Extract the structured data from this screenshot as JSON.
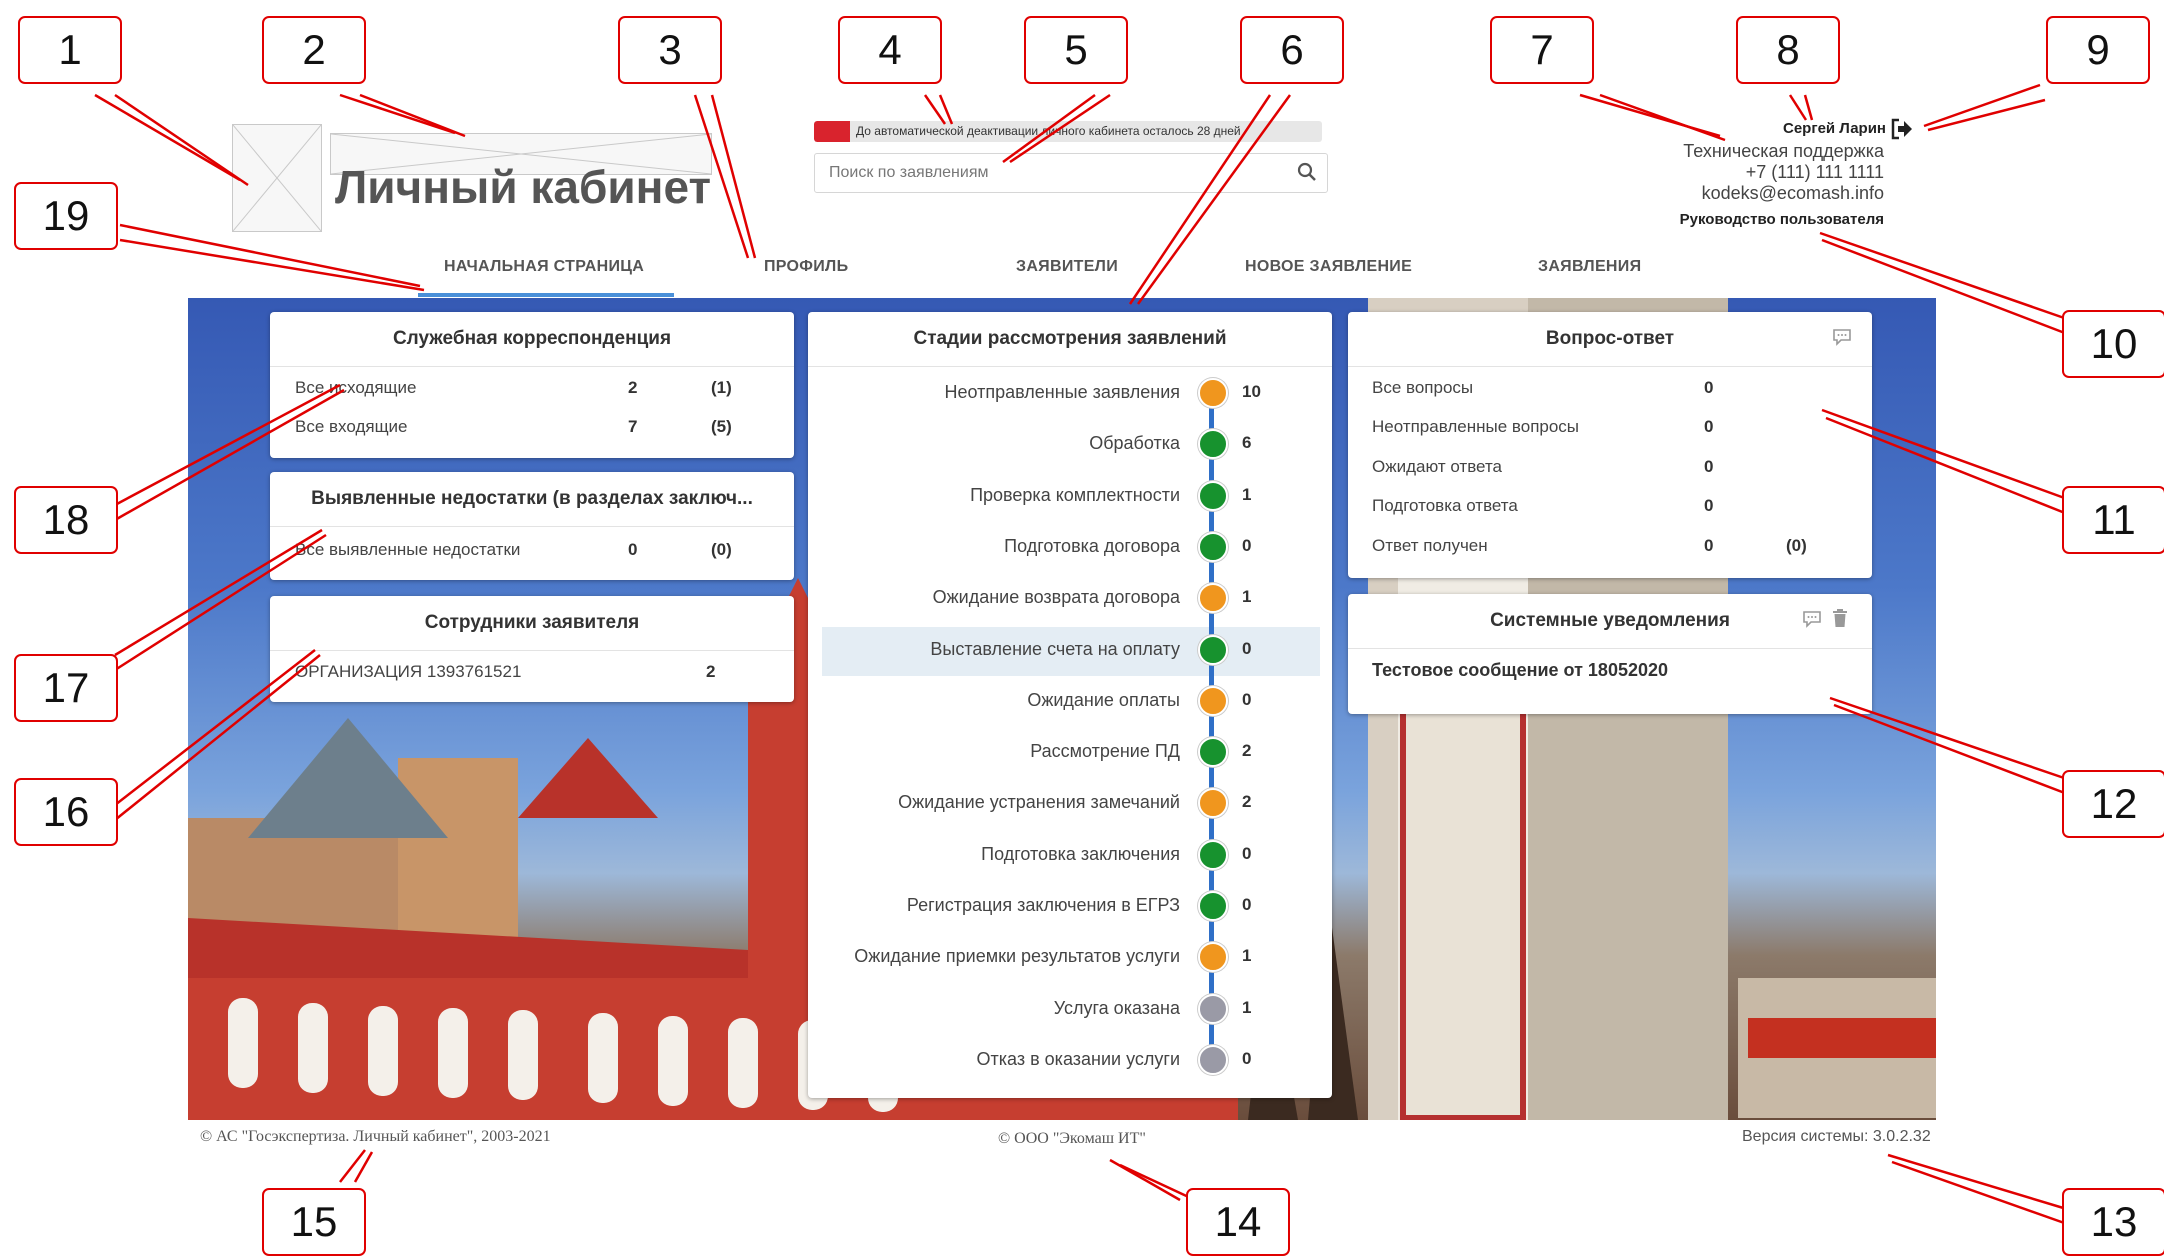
{
  "header": {
    "app_title": "Личный кабинет",
    "deactivation_text": "До автоматической деактивации личного кабинета осталось 28 дней",
    "deactivation_fraction": 0.07,
    "search_placeholder": "Поиск по заявлениям",
    "user_name": "Сергей Ларин",
    "support_title": "Техническая поддержка",
    "support_phone": "+7 (111) 111 1111",
    "support_email": "kodeks@ecomash.info",
    "user_guide": "Руководство пользователя"
  },
  "nav": {
    "items": [
      "НАЧАЛЬНАЯ СТРАНИЦА",
      "ПРОФИЛЬ",
      "ЗАЯВИТЕЛИ",
      "НОВОЕ ЗАЯВЛЕНИЕ",
      "ЗАЯВЛЕНИЯ"
    ],
    "active": "НАЧАЛЬНАЯ СТРАНИЦА"
  },
  "correspondence": {
    "title": "Служебная корреспонденция",
    "rows": [
      {
        "label": "Все исходящие",
        "count": "2",
        "extra": "(1)"
      },
      {
        "label": "Все входящие",
        "count": "7",
        "extra": "(5)"
      }
    ]
  },
  "deficiencies": {
    "title": "Выявленные недостатки (в разделах заключ...",
    "rows": [
      {
        "label": "Все выявленные недостатки",
        "count": "0",
        "extra": "(0)"
      }
    ]
  },
  "employees": {
    "title": "Сотрудники заявителя",
    "rows": [
      {
        "label": "ОРГАНИЗАЦИЯ 1393761521",
        "count": "2"
      }
    ]
  },
  "stages": {
    "title": "Стадии рассмотрения заявлений",
    "items": [
      {
        "label": "Неотправленные заявления",
        "count": "10",
        "status": "orange"
      },
      {
        "label": "Обработка",
        "count": "6",
        "status": "green"
      },
      {
        "label": "Проверка комплектности",
        "count": "1",
        "status": "green"
      },
      {
        "label": "Подготовка договора",
        "count": "0",
        "status": "green"
      },
      {
        "label": "Ожидание возврата договора",
        "count": "1",
        "status": "orange"
      },
      {
        "label": "Выставление счета на оплату",
        "count": "0",
        "status": "green"
      },
      {
        "label": "Ожидание оплаты",
        "count": "0",
        "status": "orange"
      },
      {
        "label": "Рассмотрение ПД",
        "count": "2",
        "status": "green"
      },
      {
        "label": "Ожидание устранения замечаний",
        "count": "2",
        "status": "orange"
      },
      {
        "label": "Подготовка заключения",
        "count": "0",
        "status": "green"
      },
      {
        "label": "Регистрация заключения в ЕГРЗ",
        "count": "0",
        "status": "green"
      },
      {
        "label": "Ожидание приемки результатов услуги",
        "count": "1",
        "status": "orange"
      },
      {
        "label": "Услуга оказана",
        "count": "1",
        "status": "gray"
      },
      {
        "label": "Отказ в оказании услуги",
        "count": "0",
        "status": "gray"
      }
    ],
    "highlighted": "Выставление счета на оплату"
  },
  "qa": {
    "title": "Вопрос-ответ",
    "rows": [
      {
        "label": "Все вопросы",
        "count": "0",
        "extra": ""
      },
      {
        "label": "Неотправленные вопросы",
        "count": "0",
        "extra": ""
      },
      {
        "label": "Ожидают ответа",
        "count": "0",
        "extra": ""
      },
      {
        "label": "Подготовка ответа",
        "count": "0",
        "extra": ""
      },
      {
        "label": "Ответ получен",
        "count": "0",
        "extra": "(0)"
      }
    ]
  },
  "notifications": {
    "title": "Системные уведомления",
    "message": "Тестовое сообщение от 18052020"
  },
  "footer": {
    "left": "© АС \"Госэкспертиза. Личный кабинет\", 2003-2021",
    "center": "© ООО \"Экомаш ИТ\"",
    "right": "Версия системы: 3.0.2.32"
  },
  "annotations": [
    "1",
    "2",
    "3",
    "4",
    "5",
    "6",
    "7",
    "8",
    "9",
    "10",
    "11",
    "12",
    "13",
    "14",
    "15",
    "16",
    "17",
    "18",
    "19"
  ],
  "colors": {
    "status_orange": "#f0961e",
    "status_green": "#17922e",
    "status_gray": "#9a9aa6",
    "timeline_blue": "#2f6fc7",
    "accent": "#4a90d9",
    "alert_red": "#d9232d",
    "annotation_red": "#e00000"
  },
  "icons": {
    "logout": "logout-icon",
    "search": "search-icon",
    "comment": "comment-icon",
    "trash": "trash-icon"
  }
}
